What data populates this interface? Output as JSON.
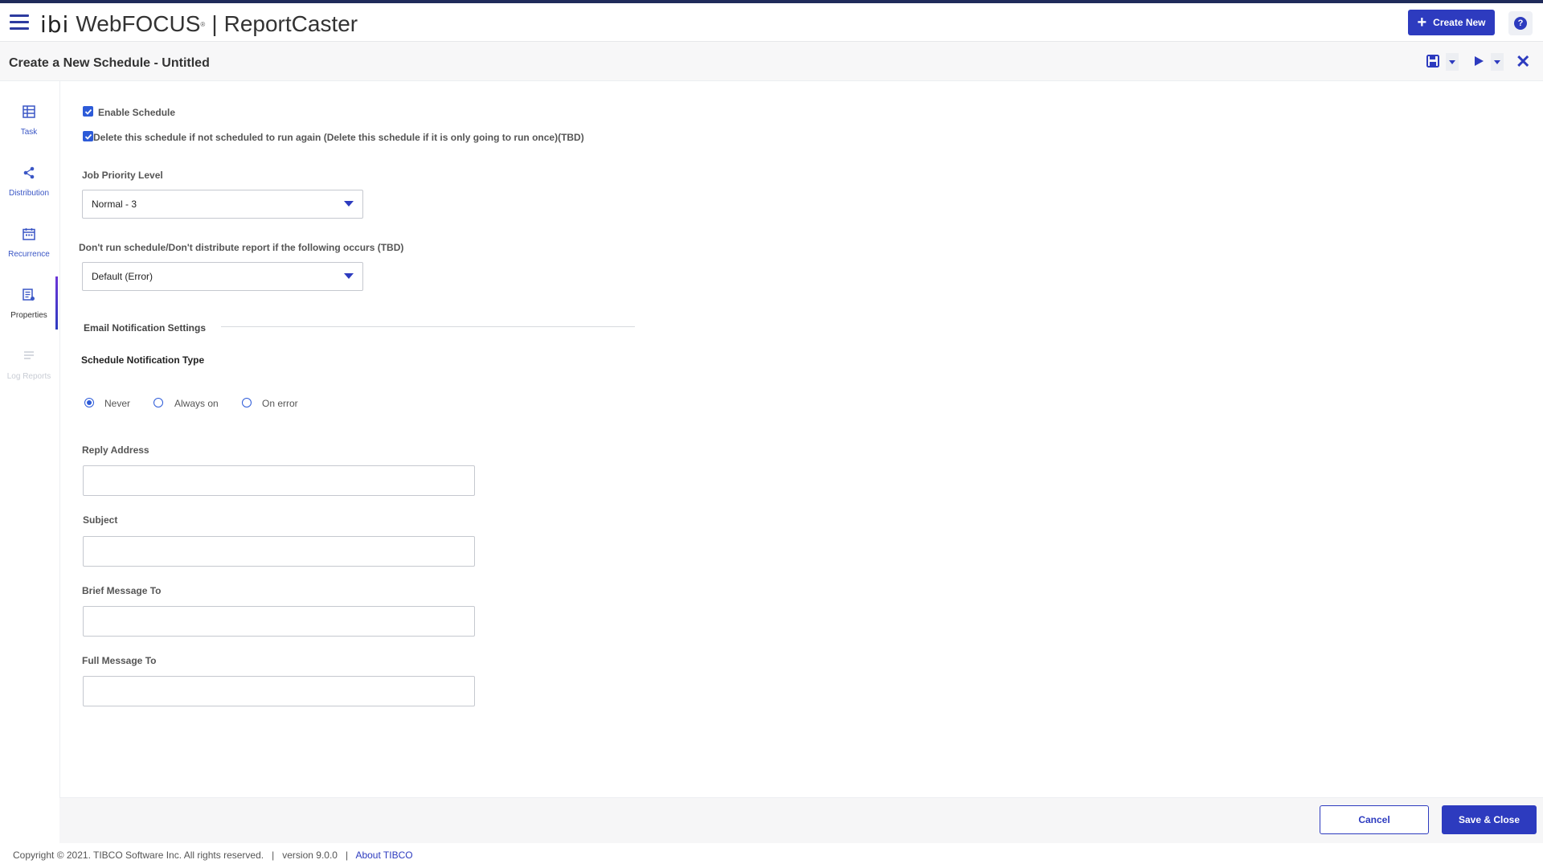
{
  "header": {
    "logo_mark": "ibi",
    "product": "WebFOCUS",
    "product_reg": "®",
    "separator": "|",
    "module": "ReportCaster",
    "create_new_label": "Create New",
    "help_label": "?"
  },
  "subheader": {
    "title": "Create a New Schedule - Untitled",
    "close_label": "✕"
  },
  "sidebar": {
    "items": [
      {
        "label": "Task",
        "icon": "table-icon",
        "state": "normal"
      },
      {
        "label": "Distribution",
        "icon": "share-icon",
        "state": "normal"
      },
      {
        "label": "Recurrence",
        "icon": "calendar-icon",
        "state": "normal"
      },
      {
        "label": "Properties",
        "icon": "properties-icon",
        "state": "active"
      },
      {
        "label": "Log Reports",
        "icon": "log-icon",
        "state": "disabled"
      }
    ]
  },
  "form": {
    "enable_schedule_label": "Enable Schedule",
    "enable_schedule_checked": true,
    "delete_schedule_label": "Delete this schedule if not scheduled to run again (Delete this schedule if it is only going to run once)(TBD)",
    "delete_schedule_checked": true,
    "job_priority_label": "Job Priority Level",
    "job_priority_value": "Normal - 3",
    "dont_run_label": "Don't run schedule/Don't distribute report if the following occurs (TBD)",
    "dont_run_value": "Default (Error)",
    "email_section_title": "Email Notification Settings",
    "notification_type_label": "Schedule Notification Type",
    "notification_options": [
      "Never",
      "Always on",
      "On error"
    ],
    "notification_selected": "Never",
    "reply_address_label": "Reply Address",
    "reply_address_value": "",
    "subject_label": "Subject",
    "subject_value": "",
    "brief_message_label": "Brief Message To",
    "brief_message_value": "",
    "full_message_label": "Full Message To",
    "full_message_value": ""
  },
  "footer": {
    "cancel_label": "Cancel",
    "save_close_label": "Save & Close",
    "copyright": "Copyright © 2021. TIBCO Software Inc. All rights reserved.",
    "sep": "|",
    "version": "version 9.0.0",
    "about_link": "About TIBCO"
  },
  "colors": {
    "accent": "#2d3bbf",
    "top_strip": "#1f2b5a",
    "checkbox": "#2d5bd8"
  }
}
